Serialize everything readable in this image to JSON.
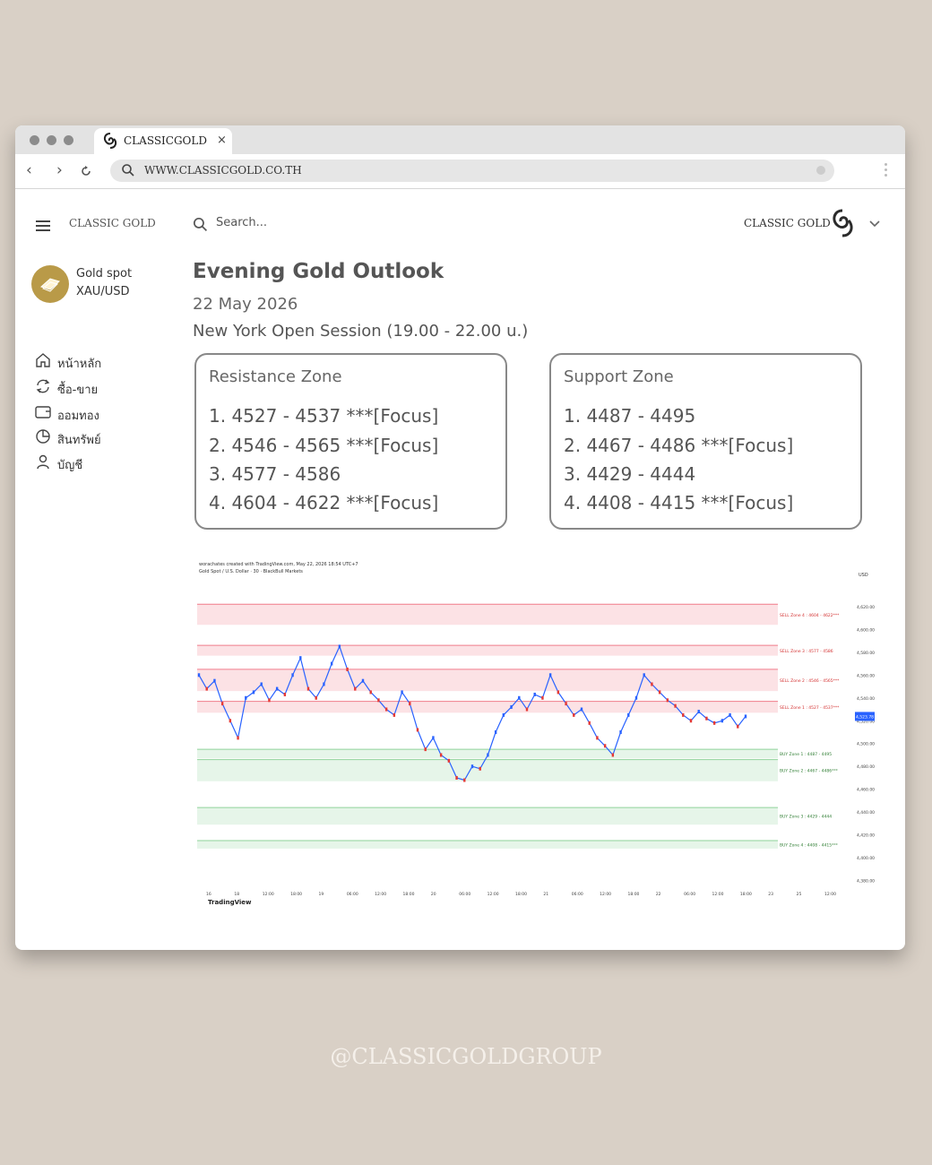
{
  "browser": {
    "tab_title": "CLASSICGOLD",
    "tab_close": "×",
    "url": "WWW.CLASSICGOLD.CO.TH"
  },
  "header": {
    "brand_left": "CLASSIC GOLD",
    "search_placeholder": "Search...",
    "brand_right": "CLASSIC GOLD"
  },
  "sidebar": {
    "product_name": "Gold spot",
    "product_symbol": "XAU/USD",
    "items": [
      {
        "label": "หน้าหลัก",
        "icon": "home-icon"
      },
      {
        "label": "ซื้อ-ขาย",
        "icon": "refresh-icon"
      },
      {
        "label": "ออมทอง",
        "icon": "wallet-icon"
      },
      {
        "label": "สินทรัพย์",
        "icon": "pie-chart-icon"
      },
      {
        "label": "บัญชี",
        "icon": "user-icon"
      }
    ]
  },
  "main": {
    "title": "Evening Gold Outlook",
    "date": "22 May 2026",
    "session": "New York Open Session (19.00 - 22.00 u.)",
    "resistance": {
      "title": "Resistance Zone",
      "items": [
        "1. 4527 - 4537 ***[Focus]",
        "2. 4546 - 4565 ***[Focus]",
        "3. 4577 - 4586",
        "4. 4604 - 4622 ***[Focus]"
      ]
    },
    "support": {
      "title": "Support Zone",
      "items": [
        "1. 4487 - 4495",
        "2. 4467 - 4486 ***[Focus]",
        "3. 4429 - 4444",
        "4. 4408 - 4415 ***[Focus]"
      ]
    }
  },
  "chart_data": {
    "type": "line",
    "header_line": "worachates created with TradingView.com, May 22, 2026 18:54 UTC+7",
    "symbol_line": "Gold Spot / U.S. Dollar · 30 · BlackBull Markets",
    "currency": "USD",
    "watermark": "TradingView",
    "last_price": "4,523.78",
    "ylim": [
      4375,
      4645
    ],
    "y_ticks": [
      "4,620.00",
      "4,600.00",
      "4,580.00",
      "4,560.00",
      "4,540.00",
      "4,520.00",
      "4,500.00",
      "4,480.00",
      "4,460.00",
      "4,440.00",
      "4,420.00",
      "4,400.00",
      "4,380.00"
    ],
    "y_tick_values": [
      4620,
      4600,
      4580,
      4560,
      4540,
      4520,
      4500,
      4480,
      4460,
      4440,
      4420,
      4400,
      4380
    ],
    "x_ticks": [
      "16",
      "18",
      "12:00",
      "18:00",
      "19",
      "06:00",
      "12:00",
      "18:00",
      "20",
      "06:00",
      "12:00",
      "18:00",
      "21",
      "06:00",
      "12:00",
      "18:00",
      "22",
      "06:00",
      "12:00",
      "18:00",
      "23",
      "25",
      "12:00"
    ],
    "zones": [
      {
        "label": "SELL Zone 4 : 4604 - 4622***",
        "low": 4604,
        "high": 4622,
        "color": "#f07b8a"
      },
      {
        "label": "SELL Zone 3 : 4577 - 4586",
        "low": 4577,
        "high": 4586,
        "color": "#f07b8a"
      },
      {
        "label": "SELL Zone 2 : 4546 - 4565***",
        "low": 4546,
        "high": 4565,
        "color": "#f07b8a"
      },
      {
        "label": "SELL Zone 1 : 4527 - 4537***",
        "low": 4527,
        "high": 4537,
        "color": "#f07b8a"
      },
      {
        "label": "BUY Zone 1 : 4487 - 4495",
        "low": 4487,
        "high": 4495,
        "color": "#8fd39a"
      },
      {
        "label": "BUY Zone 2 : 4467 - 4486***",
        "low": 4467,
        "high": 4486,
        "color": "#8fd39a"
      },
      {
        "label": "BUY Zone 3 : 4429 - 4444",
        "low": 4429,
        "high": 4444,
        "color": "#8fd39a"
      },
      {
        "label": "BUY Zone 4 : 4408 - 4415***",
        "low": 4408,
        "high": 4415,
        "color": "#8fd39a"
      }
    ],
    "series": [
      {
        "values": [
          4560,
          4548,
          4555,
          4535,
          4520,
          4505,
          4540,
          4545,
          4552,
          4538,
          4548,
          4543,
          4560,
          4575,
          4548,
          4540,
          4552,
          4570,
          4585,
          4565,
          4548,
          4555,
          4545,
          4538,
          4530,
          4525,
          4545,
          4535,
          4512,
          4495,
          4505,
          4490,
          4485,
          4470,
          4468,
          4480,
          4478,
          4490,
          4510,
          4525,
          4532,
          4540,
          4530,
          4543,
          4540,
          4560,
          4545,
          4535,
          4525,
          4530,
          4518,
          4505,
          4498,
          4490,
          4510,
          4525,
          4540,
          4560,
          4552,
          4545,
          4538,
          4533,
          4525,
          4520,
          4528,
          4522,
          4518,
          4520,
          4525,
          4515,
          4523.78
        ]
      }
    ]
  },
  "footer": "@CLASSICGOLDGROUP"
}
